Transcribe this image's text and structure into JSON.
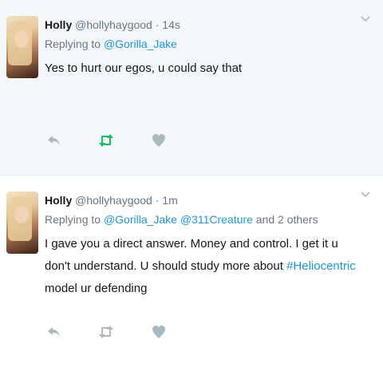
{
  "tweets": [
    {
      "name": "Holly",
      "handle": "@hollyhaygood",
      "time": "· 14s",
      "replying_prefix": "Replying to",
      "replying_links": [
        "@Gorilla_Jake"
      ],
      "replying_suffix": "",
      "text_segments": [
        {
          "text": "Yes to hurt our egos, u could say that",
          "type": "plain"
        }
      ],
      "retweeted": true
    },
    {
      "name": "Holly",
      "handle": "@hollyhaygood",
      "time": "· 1m",
      "replying_prefix": "Replying to",
      "replying_links": [
        "@Gorilla_Jake",
        "@311Creature"
      ],
      "replying_suffix": "and 2 others",
      "text_segments": [
        {
          "text": "I gave you a direct answer. Money and control. I get it u don't understand.  U should study more about ",
          "type": "plain"
        },
        {
          "text": "#Heliocentric",
          "type": "link"
        },
        {
          "text": " model ur defending",
          "type": "plain"
        }
      ],
      "retweeted": false
    }
  ],
  "colors": {
    "link": "#1b95e0",
    "meta": "#657786",
    "icon": "#aab8c2",
    "retweet_active": "#17bf63"
  },
  "icons": [
    "reply-icon",
    "retweet-icon",
    "like-icon",
    "chevron-down-icon"
  ]
}
